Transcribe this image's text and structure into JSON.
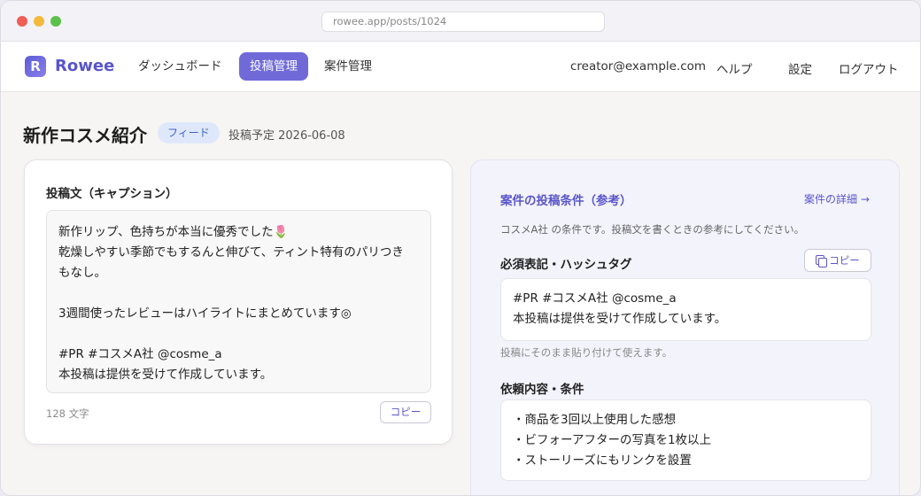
{
  "browser": {
    "url": "rowee.app/posts/1024"
  },
  "nav": {
    "logo_letter": "R",
    "logo_text": "Rowee",
    "items": [
      {
        "label": "ダッシュボード"
      },
      {
        "label": "投稿管理"
      },
      {
        "label": "案件管理"
      }
    ],
    "user_email": "creator@example.com",
    "help": "ヘルプ",
    "settings": "設定",
    "logout": "ログアウト"
  },
  "page": {
    "title": "新作コスメ紹介",
    "badge": "フィード",
    "schedule": "投稿予定 2026-06-08"
  },
  "caption": {
    "label": "投稿文（キャプション）",
    "lines": [
      "新作リップ、色持ちが本当に優秀でした🌷",
      "乾燥しやすい季節でもするんと伸びて、ティント特有のパリつき",
      "もなし。",
      "",
      "3週間使ったレビューはハイライトにまとめています◎",
      "",
      "#PR #コスメA社 @cosme_a",
      "本投稿は提供を受けて作成しています。"
    ],
    "count": "128 文字",
    "copy_label": "コピー"
  },
  "conditions": {
    "title": "案件の投稿条件（参考）",
    "detail_link": "案件の詳細 →",
    "description": "コスメA社 の条件です。投稿文を書くときの参考にしてください。",
    "required": {
      "label": "必須表記・ハッシュタグ",
      "copy_label": "コピー",
      "lines": [
        "#PR #コスメA社 @cosme_a",
        "本投稿は提供を受けて作成しています。"
      ],
      "note": "投稿にそのまま貼り付けて使えます。"
    },
    "request": {
      "label": "依頼内容・条件",
      "lines": [
        "・商品を3回以上使用した感想",
        "・ビフォーアフターの写真を1枚以上",
        "・ストーリーズにもリンクを設置"
      ]
    }
  }
}
